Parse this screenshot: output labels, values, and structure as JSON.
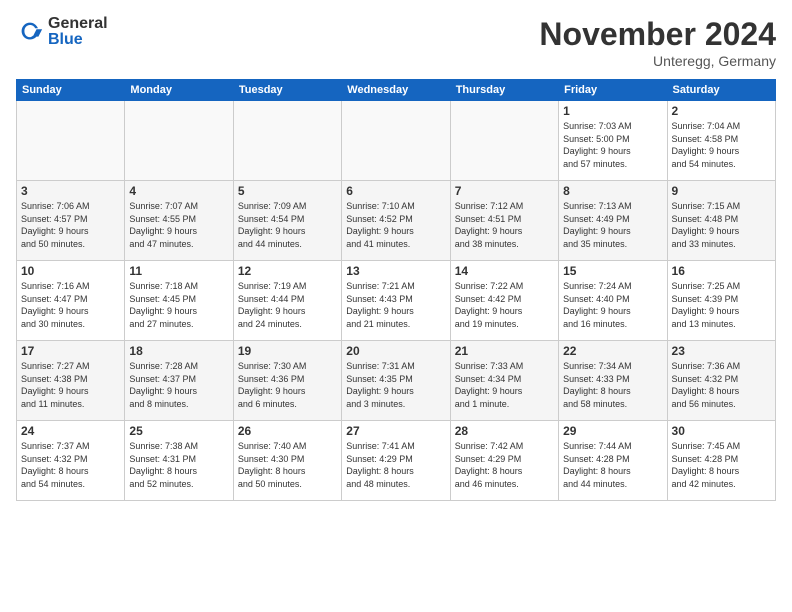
{
  "logo": {
    "general": "General",
    "blue": "Blue"
  },
  "header": {
    "title": "November 2024",
    "subtitle": "Unteregg, Germany"
  },
  "weekdays": [
    "Sunday",
    "Monday",
    "Tuesday",
    "Wednesday",
    "Thursday",
    "Friday",
    "Saturday"
  ],
  "weeks": [
    [
      {
        "day": "",
        "info": ""
      },
      {
        "day": "",
        "info": ""
      },
      {
        "day": "",
        "info": ""
      },
      {
        "day": "",
        "info": ""
      },
      {
        "day": "",
        "info": ""
      },
      {
        "day": "1",
        "info": "Sunrise: 7:03 AM\nSunset: 5:00 PM\nDaylight: 9 hours\nand 57 minutes."
      },
      {
        "day": "2",
        "info": "Sunrise: 7:04 AM\nSunset: 4:58 PM\nDaylight: 9 hours\nand 54 minutes."
      }
    ],
    [
      {
        "day": "3",
        "info": "Sunrise: 7:06 AM\nSunset: 4:57 PM\nDaylight: 9 hours\nand 50 minutes."
      },
      {
        "day": "4",
        "info": "Sunrise: 7:07 AM\nSunset: 4:55 PM\nDaylight: 9 hours\nand 47 minutes."
      },
      {
        "day": "5",
        "info": "Sunrise: 7:09 AM\nSunset: 4:54 PM\nDaylight: 9 hours\nand 44 minutes."
      },
      {
        "day": "6",
        "info": "Sunrise: 7:10 AM\nSunset: 4:52 PM\nDaylight: 9 hours\nand 41 minutes."
      },
      {
        "day": "7",
        "info": "Sunrise: 7:12 AM\nSunset: 4:51 PM\nDaylight: 9 hours\nand 38 minutes."
      },
      {
        "day": "8",
        "info": "Sunrise: 7:13 AM\nSunset: 4:49 PM\nDaylight: 9 hours\nand 35 minutes."
      },
      {
        "day": "9",
        "info": "Sunrise: 7:15 AM\nSunset: 4:48 PM\nDaylight: 9 hours\nand 33 minutes."
      }
    ],
    [
      {
        "day": "10",
        "info": "Sunrise: 7:16 AM\nSunset: 4:47 PM\nDaylight: 9 hours\nand 30 minutes."
      },
      {
        "day": "11",
        "info": "Sunrise: 7:18 AM\nSunset: 4:45 PM\nDaylight: 9 hours\nand 27 minutes."
      },
      {
        "day": "12",
        "info": "Sunrise: 7:19 AM\nSunset: 4:44 PM\nDaylight: 9 hours\nand 24 minutes."
      },
      {
        "day": "13",
        "info": "Sunrise: 7:21 AM\nSunset: 4:43 PM\nDaylight: 9 hours\nand 21 minutes."
      },
      {
        "day": "14",
        "info": "Sunrise: 7:22 AM\nSunset: 4:42 PM\nDaylight: 9 hours\nand 19 minutes."
      },
      {
        "day": "15",
        "info": "Sunrise: 7:24 AM\nSunset: 4:40 PM\nDaylight: 9 hours\nand 16 minutes."
      },
      {
        "day": "16",
        "info": "Sunrise: 7:25 AM\nSunset: 4:39 PM\nDaylight: 9 hours\nand 13 minutes."
      }
    ],
    [
      {
        "day": "17",
        "info": "Sunrise: 7:27 AM\nSunset: 4:38 PM\nDaylight: 9 hours\nand 11 minutes."
      },
      {
        "day": "18",
        "info": "Sunrise: 7:28 AM\nSunset: 4:37 PM\nDaylight: 9 hours\nand 8 minutes."
      },
      {
        "day": "19",
        "info": "Sunrise: 7:30 AM\nSunset: 4:36 PM\nDaylight: 9 hours\nand 6 minutes."
      },
      {
        "day": "20",
        "info": "Sunrise: 7:31 AM\nSunset: 4:35 PM\nDaylight: 9 hours\nand 3 minutes."
      },
      {
        "day": "21",
        "info": "Sunrise: 7:33 AM\nSunset: 4:34 PM\nDaylight: 9 hours\nand 1 minute."
      },
      {
        "day": "22",
        "info": "Sunrise: 7:34 AM\nSunset: 4:33 PM\nDaylight: 8 hours\nand 58 minutes."
      },
      {
        "day": "23",
        "info": "Sunrise: 7:36 AM\nSunset: 4:32 PM\nDaylight: 8 hours\nand 56 minutes."
      }
    ],
    [
      {
        "day": "24",
        "info": "Sunrise: 7:37 AM\nSunset: 4:32 PM\nDaylight: 8 hours\nand 54 minutes."
      },
      {
        "day": "25",
        "info": "Sunrise: 7:38 AM\nSunset: 4:31 PM\nDaylight: 8 hours\nand 52 minutes."
      },
      {
        "day": "26",
        "info": "Sunrise: 7:40 AM\nSunset: 4:30 PM\nDaylight: 8 hours\nand 50 minutes."
      },
      {
        "day": "27",
        "info": "Sunrise: 7:41 AM\nSunset: 4:29 PM\nDaylight: 8 hours\nand 48 minutes."
      },
      {
        "day": "28",
        "info": "Sunrise: 7:42 AM\nSunset: 4:29 PM\nDaylight: 8 hours\nand 46 minutes."
      },
      {
        "day": "29",
        "info": "Sunrise: 7:44 AM\nSunset: 4:28 PM\nDaylight: 8 hours\nand 44 minutes."
      },
      {
        "day": "30",
        "info": "Sunrise: 7:45 AM\nSunset: 4:28 PM\nDaylight: 8 hours\nand 42 minutes."
      }
    ]
  ]
}
